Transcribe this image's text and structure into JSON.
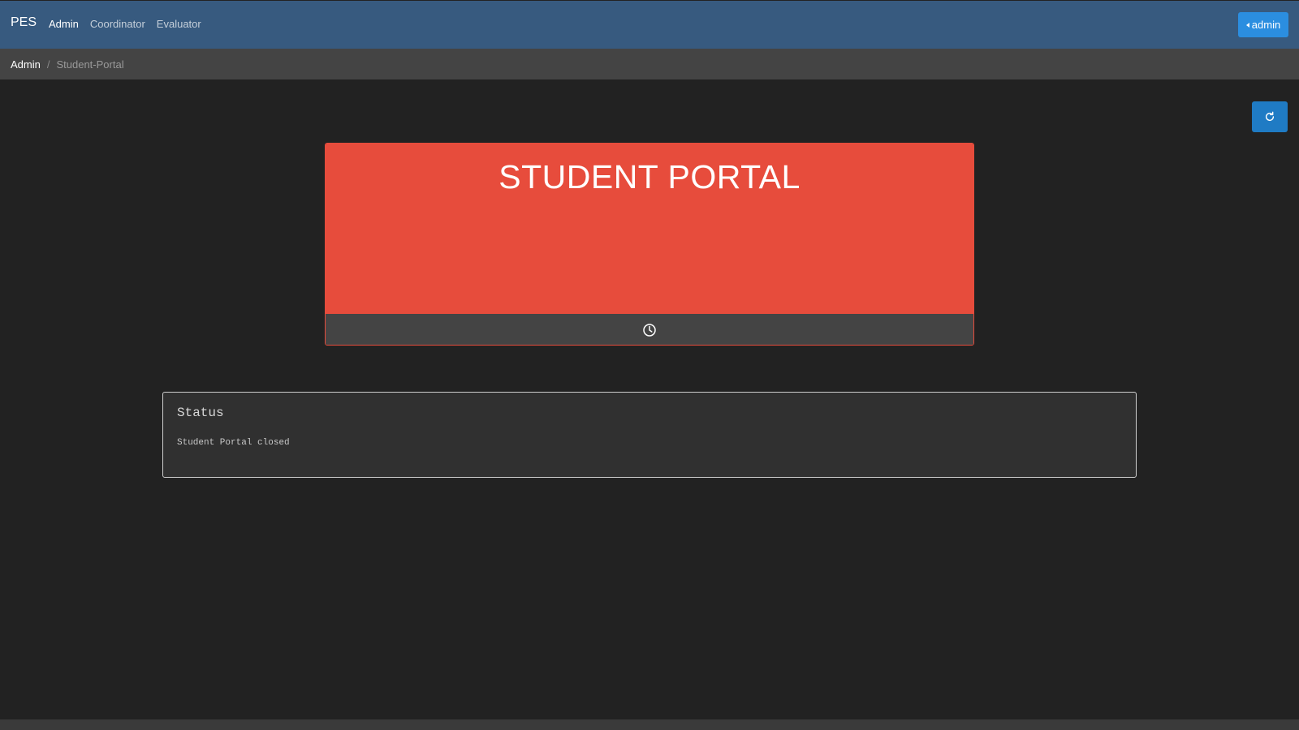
{
  "navbar": {
    "brand": "PES",
    "links": [
      {
        "label": "Admin",
        "active": true
      },
      {
        "label": "Coordinator",
        "active": false
      },
      {
        "label": "Evaluator",
        "active": false
      }
    ],
    "user_label": "admin",
    "user_icon": "caret-left-icon"
  },
  "breadcrumb": {
    "items": [
      "Admin",
      "Student-Portal"
    ]
  },
  "toolbar": {
    "refresh_icon": "refresh-icon"
  },
  "portal_card": {
    "title": "STUDENT PORTAL",
    "footer_icon": "clock-icon",
    "color": "#e74c3c"
  },
  "status": {
    "heading": "Status",
    "message": "Student Portal closed"
  },
  "colors": {
    "navbar": "#375a7f",
    "accent": "#2b8ee0",
    "background": "#222222"
  }
}
